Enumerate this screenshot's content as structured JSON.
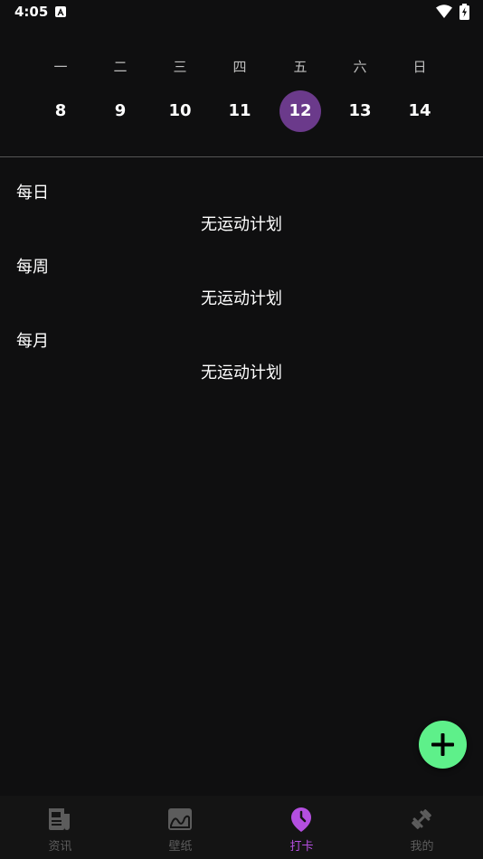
{
  "status_bar": {
    "time": "4:05"
  },
  "calendar": {
    "weekdays": [
      "一",
      "二",
      "三",
      "四",
      "五",
      "六",
      "日"
    ],
    "dates": [
      "8",
      "9",
      "10",
      "11",
      "12",
      "13",
      "14"
    ],
    "selected_date": "12",
    "selected_color": "#6b3a8b"
  },
  "sections": [
    {
      "title": "每日",
      "empty_text": "无运动计划"
    },
    {
      "title": "每周",
      "empty_text": "无运动计划"
    },
    {
      "title": "每月",
      "empty_text": "无运动计划"
    }
  ],
  "fab": {
    "icon": "plus-icon",
    "color": "#5ef08a"
  },
  "bottom_nav": {
    "items": [
      {
        "label": "资讯",
        "icon": "news-icon",
        "active": false
      },
      {
        "label": "壁纸",
        "icon": "image-icon",
        "active": false
      },
      {
        "label": "打卡",
        "icon": "clock-pin-icon",
        "active": true
      },
      {
        "label": "我的",
        "icon": "dumbbell-icon",
        "active": false
      }
    ],
    "active_color": "#b44fe0",
    "inactive_color": "#5c5c5c"
  }
}
